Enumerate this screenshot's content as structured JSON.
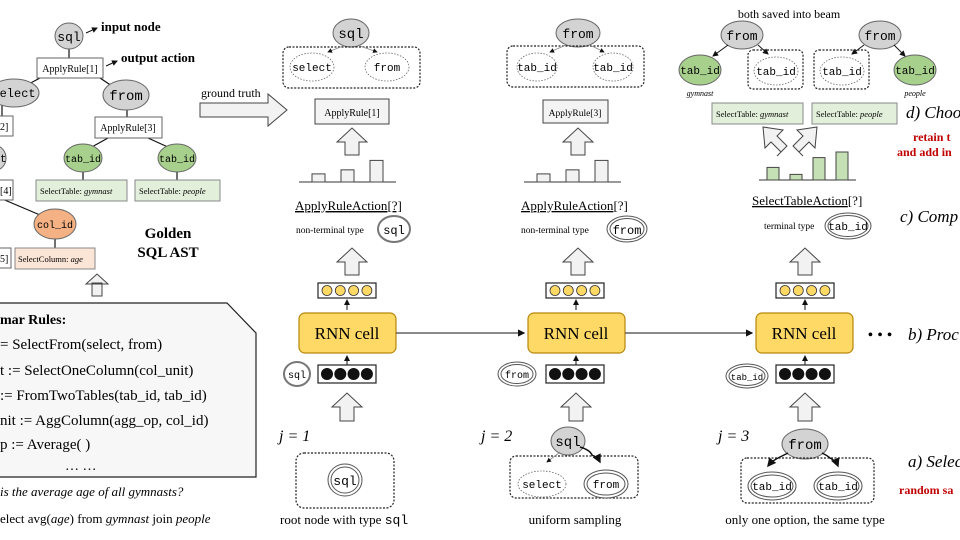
{
  "golden_ast": {
    "title_line1": "Golden",
    "title_line2": "SQL AST",
    "input_node_label": "input node",
    "output_action_label": "output action",
    "nodes": {
      "sql": "sql",
      "select": "select",
      "from": "from",
      "select_child": "t",
      "tab_id_left": "tab_id",
      "tab_id_right": "tab_id",
      "col_id": "col_id"
    },
    "actions": {
      "apply_rule_1": "ApplyRule[1]",
      "apply_rule_2": "2]",
      "apply_rule_3": "ApplyRule[3]",
      "apply_rule_4": "[4]",
      "apply_rule_5": "5]",
      "select_table_gymnast_prefix": "SelectTable: ",
      "select_table_gymnast_value": "gymnast",
      "select_table_people_prefix": "SelectTable: ",
      "select_table_people_value": "people",
      "select_column_prefix": "SelectColumn: ",
      "select_column_value": "age"
    }
  },
  "grammar": {
    "title": "mar Rules:",
    "rules": [
      "= SelectFrom(select, from)",
      "t := SelectOneColumn(col_unit)",
      ":= FromTwoTables(tab_id, tab_id)",
      "nit := AggColumn(agg_op, col_id)",
      "p := Average( )",
      "… …"
    ],
    "question": "is the average age of all gymnasts?",
    "sql_prefix": "elect avg(",
    "sql_col": "age",
    "sql_mid": ") from ",
    "sql_t1": "gymnast",
    "sql_join": " join ",
    "sql_t2": "people"
  },
  "ground_truth_label": "ground truth",
  "steps": [
    {
      "parent": "sql",
      "children": [
        "select",
        "from"
      ],
      "action": "ApplyRule[1]",
      "action_type": "ApplyRuleAction",
      "action_suffix": "[?]",
      "type_label": "non-terminal type",
      "type_node": "sql",
      "input_node": "sql",
      "j_label": "j = 1",
      "bottom_nodes": [
        "sql"
      ],
      "bottom_caption": "root node with type ",
      "bottom_caption_code": "sql",
      "rnn_label": "RNN cell",
      "bar_values": [
        0.3,
        0.45,
        0.8
      ]
    },
    {
      "parent": "from",
      "children": [
        "tab_id",
        "tab_id"
      ],
      "action": "ApplyRule[3]",
      "action_type": "ApplyRuleAction",
      "action_suffix": "[?]",
      "type_label": "non-terminal type",
      "type_node": "from",
      "input_node": "from",
      "j_label": "j = 2",
      "bottom_parent": "sql",
      "bottom_nodes": [
        "select",
        "from"
      ],
      "bottom_caption": "uniform sampling",
      "rnn_label": "RNN cell",
      "bar_values": [
        0.3,
        0.45,
        0.8
      ]
    },
    {
      "beam_label": "both saved into beam",
      "parent": "from",
      "left_tree": {
        "filled": "tab_id",
        "filled_caption": "gymnast",
        "empty": "tab_id"
      },
      "right_tree": {
        "filled": "tab_id",
        "filled_caption": "people",
        "empty": "tab_id"
      },
      "actions": [
        {
          "prefix": "SelectTable: ",
          "value": "gymnast"
        },
        {
          "prefix": "SelectTable: ",
          "value": "people"
        }
      ],
      "action_type": "SelectTableAction",
      "action_suffix": "[?]",
      "type_label": "terminal type",
      "type_node": "tab_id",
      "input_node": "tab_id",
      "j_label": "j = 3",
      "bottom_parent": "from",
      "bottom_nodes": [
        "tab_id",
        "tab_id"
      ],
      "bottom_caption": "only one option, the same type",
      "rnn_label": "RNN cell",
      "bar_values": [
        0.45,
        0.2,
        0.8,
        1.0
      ]
    }
  ],
  "ellipsis": "• • •",
  "stage_labels": {
    "d": "d) Choo",
    "d_note_1": "retain t",
    "d_note_2": "and add in",
    "c": "c) Comp",
    "b": "b) Proc",
    "a": "a) Selec",
    "a_note": "random sa"
  },
  "colors": {
    "node_gray": "#d3d3d3",
    "node_green": "#a8d08d",
    "node_orange": "#f4b183",
    "box_green": "#e2efda",
    "box_orange": "#fbe5d6",
    "rnn_yellow": "#ffd966",
    "rnn_border": "#b8860b",
    "arrow_fill": "#f2f2f2",
    "accent_red": "#c00000"
  }
}
